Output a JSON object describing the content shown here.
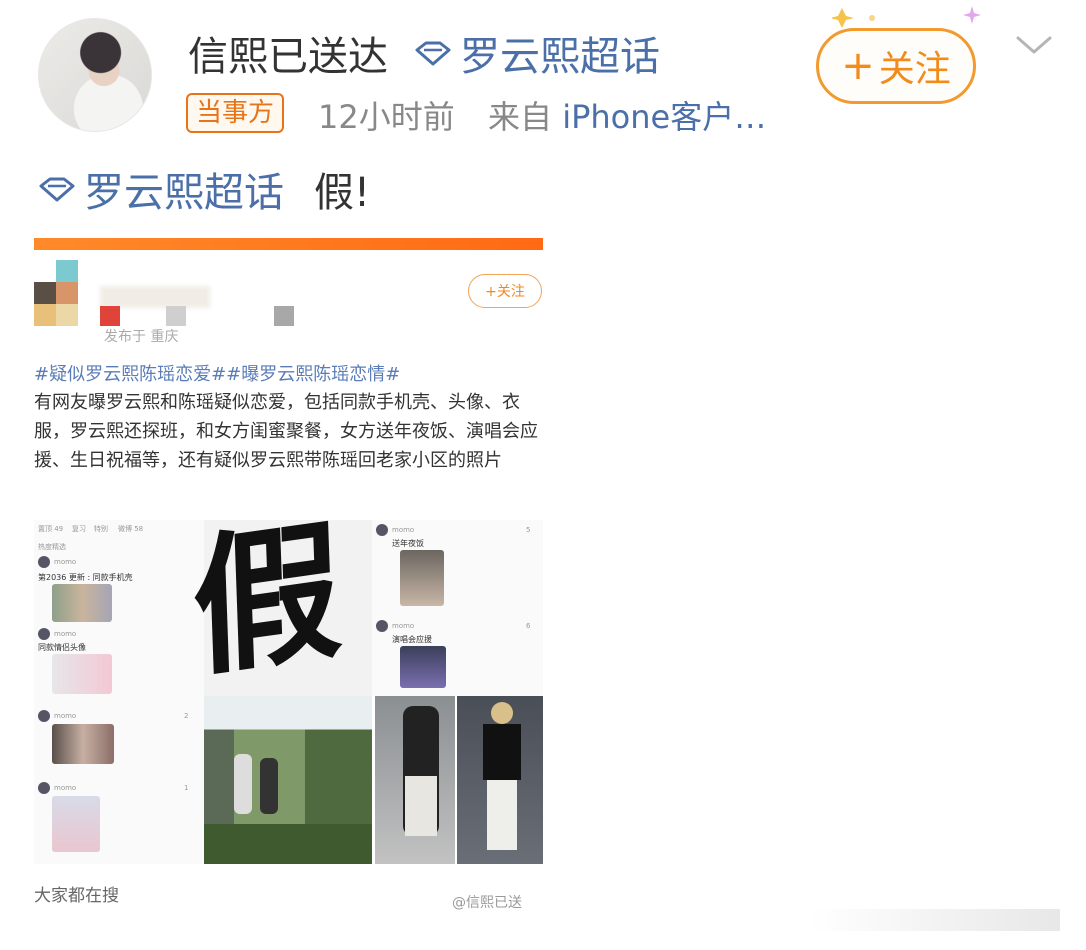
{
  "post": {
    "username": "信熙已送达",
    "topic_link": "罗云熙超话",
    "badge": "当事方",
    "time": "12小时前",
    "source_prefix": "来自",
    "source_device": "iPhone客户…",
    "follow_label": "关注",
    "follow_plus": "+",
    "text_topic": "罗云熙超话",
    "text_body": "假!"
  },
  "embedded": {
    "follow_label": "+关注",
    "location": "发布于 重庆",
    "hashtags": "#疑似罗云熙陈瑶恋爱##曝罗云熙陈瑶恋情#",
    "body": "有网友曝罗云熙和陈瑶疑似恋爱，包括同款手机壳、头像、衣服，罗云熙还探班，和女方闺蜜聚餐，女方送年夜饭、演唱会应援、生日祝福等，还有疑似罗云熙带陈瑶回老家小区的照片",
    "overlay_char": "假",
    "left_panel": {
      "tabs": [
        "置顶 49",
        "复习",
        "特别",
        "微博 58"
      ],
      "section": "热度精选",
      "posts": [
        {
          "author": "momo",
          "caption": "第2036 更新 : 同款手机壳",
          "likes": ""
        },
        {
          "author": "momo",
          "caption": "同款情侣头像",
          "likes": ""
        },
        {
          "author": "momo",
          "caption": "",
          "likes": "2"
        },
        {
          "author": "momo",
          "caption": "",
          "likes": "1"
        }
      ]
    },
    "right_panel": {
      "posts": [
        {
          "author": "momo",
          "caption": "送年夜饭",
          "likes": "5"
        },
        {
          "author": "momo",
          "caption": "演唱会应援",
          "likes": "6"
        }
      ]
    },
    "search_title": "大家都在搜",
    "watermark": "@信熙已送"
  },
  "colors": {
    "accent_orange": "#f28b1a",
    "link_blue": "#4b6fa8",
    "text_dark": "#333333",
    "text_gray": "#888888"
  },
  "icons": [
    "diamond-icon",
    "plus-icon",
    "chevron-down-icon",
    "sparkle-icon"
  ]
}
